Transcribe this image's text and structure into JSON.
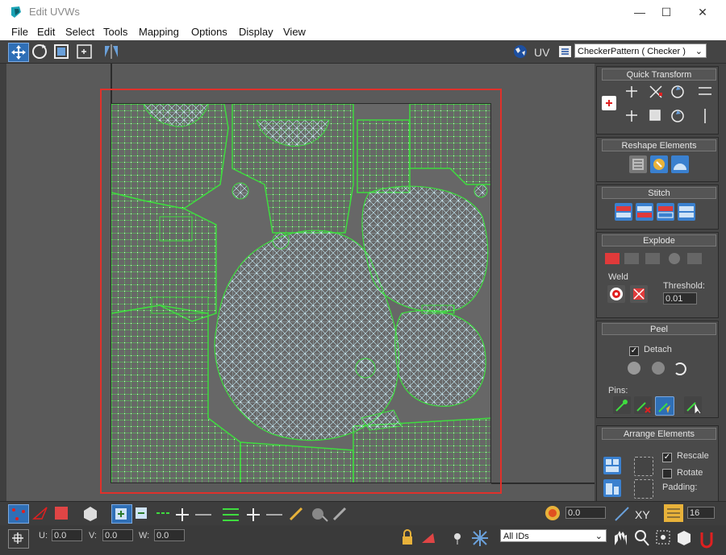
{
  "window": {
    "title": "Edit UVWs",
    "minimize": "—",
    "maximize": "☐",
    "close": "✕"
  },
  "menu": [
    "File",
    "Edit",
    "Select",
    "Tools",
    "Mapping",
    "Options",
    "Display",
    "View"
  ],
  "toolbar": {
    "uv_label": "UV",
    "texture_select": "CheckerPattern  ( Checker )"
  },
  "panel": {
    "quick_transform": "Quick Transform",
    "reshape_elements": "Reshape Elements",
    "stitch": "Stitch",
    "explode": "Explode",
    "weld": "Weld",
    "threshold_label": "Threshold:",
    "threshold_value": "0.01",
    "peel": "Peel",
    "detach_label": "Detach",
    "pins_label": "Pins:",
    "arrange_elements": "Arrange Elements",
    "rescale_label": "Rescale",
    "rotate_label": "Rotate",
    "padding_label": "Padding:"
  },
  "bottom": {
    "soft_value": "0.0",
    "xy_label": "XY",
    "grid_value": "16",
    "u_label": "U:",
    "u_value": "0.0",
    "v_label": "V:",
    "v_value": "0.0",
    "w_label": "W:",
    "w_value": "0.0",
    "ids_select": "All IDs"
  },
  "colors": {
    "accent": "#2f6fb6",
    "red_rect": "#e0312b",
    "uv_green": "#3fdc3f",
    "uv_cyan": "#bfefff"
  }
}
